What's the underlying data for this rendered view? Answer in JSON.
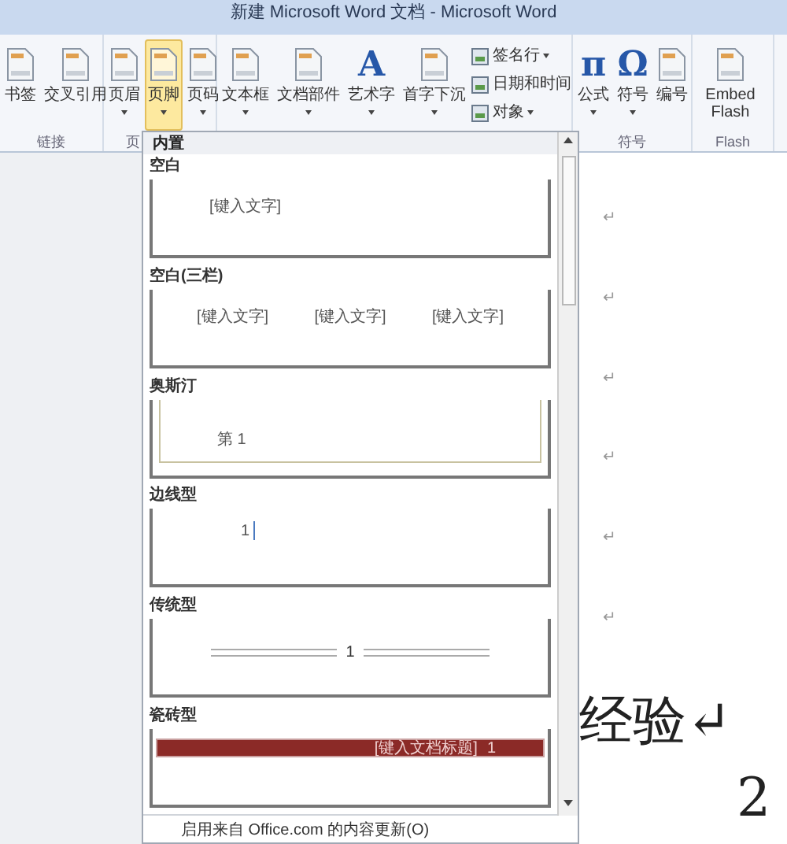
{
  "window": {
    "title": "新建 Microsoft Word 文档 - Microsoft Word"
  },
  "ribbon": {
    "groups": [
      {
        "label": "链接",
        "buttons": [
          {
            "kind": "large",
            "label": "书签",
            "selected": false,
            "caret": false
          },
          {
            "kind": "large",
            "label": "交叉引用",
            "selected": false,
            "caret": false
          }
        ]
      },
      {
        "label": "页",
        "buttons": [
          {
            "kind": "large",
            "label": "页眉",
            "selected": false,
            "caret": true
          },
          {
            "kind": "large",
            "label": "页脚",
            "selected": true,
            "caret": true
          },
          {
            "kind": "large",
            "label": "页码",
            "selected": false,
            "caret": true
          }
        ]
      },
      {
        "buttons": [
          {
            "kind": "large",
            "label": "文本框",
            "selected": false,
            "caret": true
          },
          {
            "kind": "large",
            "label": "文档部件",
            "selected": false,
            "caret": true
          },
          {
            "kind": "large",
            "label": "艺术字",
            "selected": false,
            "caret": true,
            "glyph": "A"
          },
          {
            "kind": "large",
            "label": "首字下沉",
            "selected": false,
            "caret": true
          },
          {
            "kind": "small",
            "items": [
              {
                "label": "签名行",
                "caret": true
              },
              {
                "label": "日期和时间",
                "caret": false
              },
              {
                "label": "对象",
                "caret": true
              }
            ]
          }
        ]
      },
      {
        "label": "符号",
        "buttons": [
          {
            "kind": "large",
            "label": "公式",
            "selected": false,
            "caret": true,
            "glyph": "π"
          },
          {
            "kind": "large",
            "label": "符号",
            "selected": false,
            "caret": true,
            "glyph": "Ω"
          },
          {
            "kind": "large",
            "label": "编号",
            "selected": false,
            "caret": false
          }
        ]
      },
      {
        "label": "Flash",
        "buttons": [
          {
            "kind": "large",
            "label": "Embed Flash",
            "selected": false,
            "caret": false
          }
        ]
      }
    ]
  },
  "gallery": {
    "header": "内置",
    "items": [
      {
        "title": "空白",
        "kind": "blank",
        "texts": [
          "[键入文字]"
        ]
      },
      {
        "title": "空白(三栏)",
        "kind": "three",
        "texts": [
          "[键入文字]",
          "[键入文字]",
          "[键入文字]"
        ]
      },
      {
        "title": "奥斯汀",
        "kind": "austin",
        "texts": [
          "第 1"
        ]
      },
      {
        "title": "边线型",
        "kind": "border",
        "texts": [
          "1"
        ]
      },
      {
        "title": "传统型",
        "kind": "traditional",
        "texts": [
          "1"
        ]
      },
      {
        "title": "瓷砖型",
        "kind": "tile",
        "texts": [
          "[键入文档标题]",
          "1"
        ]
      }
    ],
    "footer": "启用来自 Office.com 的内容更新(O)"
  },
  "document": {
    "lines": [
      {
        "kind": "mark",
        "text": "↵"
      },
      {
        "kind": "mark",
        "text": "↵"
      },
      {
        "kind": "mark",
        "text": "↵"
      },
      {
        "kind": "mark",
        "text": "↵"
      },
      {
        "kind": "mark",
        "text": "↵"
      },
      {
        "kind": "mark",
        "text": "↵"
      },
      {
        "kind": "big",
        "text": "经验↵"
      },
      {
        "kind": "big",
        "text": "2"
      }
    ]
  }
}
